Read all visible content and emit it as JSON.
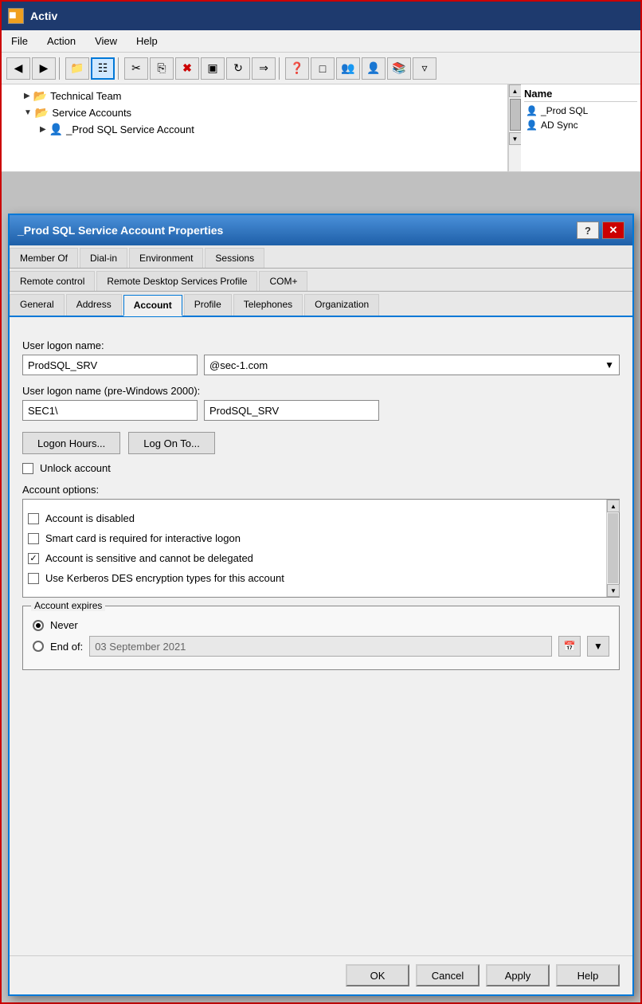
{
  "titlebar": {
    "icon": "window-icon",
    "title": "Activ"
  },
  "menubar": {
    "items": [
      {
        "label": "File",
        "id": "file"
      },
      {
        "label": "Action",
        "id": "action"
      },
      {
        "label": "View",
        "id": "view"
      },
      {
        "label": "Help",
        "id": "help"
      }
    ]
  },
  "tree": {
    "items": [
      {
        "label": "Technical Team",
        "type": "folder",
        "indent": 1,
        "expanded": false
      },
      {
        "label": "Service Accounts",
        "type": "folder",
        "indent": 1,
        "expanded": true
      },
      {
        "label": "_Prod SQL Service Account",
        "type": "user",
        "indent": 2
      }
    ]
  },
  "namepanel": {
    "header": "Name",
    "items": [
      {
        "label": "_Prod SQL",
        "type": "user"
      },
      {
        "label": "AD Sync",
        "type": "user"
      }
    ]
  },
  "dialog": {
    "title": "_Prod SQL Service Account Properties",
    "tabs_row1": [
      {
        "label": "Member Of",
        "active": false
      },
      {
        "label": "Dial-in",
        "active": false
      },
      {
        "label": "Environment",
        "active": false
      },
      {
        "label": "Sessions",
        "active": false
      }
    ],
    "tabs_row2": [
      {
        "label": "Remote control",
        "active": false
      },
      {
        "label": "Remote Desktop Services Profile",
        "active": false
      },
      {
        "label": "COM+",
        "active": false
      }
    ],
    "tabs_row3": [
      {
        "label": "General",
        "active": false
      },
      {
        "label": "Address",
        "active": false
      },
      {
        "label": "Account",
        "active": true
      },
      {
        "label": "Profile",
        "active": false
      },
      {
        "label": "Telephones",
        "active": false
      },
      {
        "label": "Organization",
        "active": false
      }
    ],
    "form": {
      "logon_name_label": "User logon name:",
      "logon_name_value": "ProdSQL_SRV",
      "domain_value": "@sec-1.com",
      "pre2000_label": "User logon name (pre-Windows 2000):",
      "pre2000_domain": "SEC1\\",
      "pre2000_name": "ProdSQL_SRV",
      "logon_hours_btn": "Logon Hours...",
      "logon_to_btn": "Log On To...",
      "unlock_label": "Unlock account",
      "account_options_label": "Account options:",
      "options": [
        {
          "label": "Account is disabled",
          "checked": false
        },
        {
          "label": "Smart card is required for interactive logon",
          "checked": false
        },
        {
          "label": "Account is sensitive and cannot be delegated",
          "checked": true
        },
        {
          "label": "Use Kerberos DES encryption types for this account",
          "checked": false
        }
      ],
      "expires_legend": "Account expires",
      "never_label": "Never",
      "end_of_label": "End of:",
      "end_of_date": "03 September 2021"
    },
    "buttons": {
      "ok": "OK",
      "cancel": "Cancel",
      "apply": "Apply",
      "help": "Help"
    }
  }
}
